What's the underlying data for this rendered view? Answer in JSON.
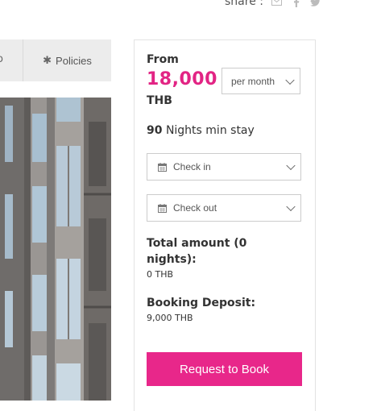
{
  "share": {
    "label": "share :",
    "icons": [
      "envelope-icon",
      "facebook-icon",
      "twitter-icon"
    ]
  },
  "tabs": {
    "previous_fragment": "o",
    "policies_label": "Policies",
    "policies_icon": "asterisk-icon"
  },
  "booking": {
    "from_label": "From",
    "price": "18,000",
    "currency": "THB",
    "period_selected": "per month",
    "min_stay_number": "90",
    "min_stay_text": "Nights min stay",
    "checkin_placeholder": "Check in",
    "checkout_placeholder": "Check out",
    "total_label": "Total amount (0 nights):",
    "total_value": "0 THB",
    "deposit_label": "Booking Deposit:",
    "deposit_value": "9,000 THB",
    "button_label": "Request to Book"
  },
  "colors": {
    "accent": "#e22484",
    "button": "#e8278a",
    "tab_bg": "#ececec"
  }
}
